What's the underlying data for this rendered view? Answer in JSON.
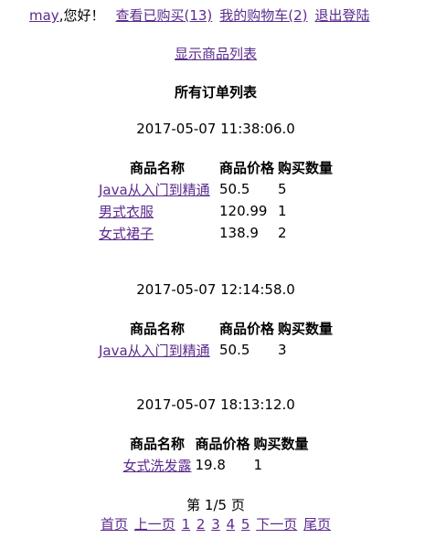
{
  "header": {
    "user_name": "may",
    "greeting": ",您好！",
    "purchased_link": "查看已购买(13)",
    "cart_link": "我的购物车(2)",
    "logout_link": "退出登陆"
  },
  "show_products_link": "显示商品列表",
  "page_title": "所有订单列表",
  "columns": {
    "name": "商品名称",
    "price": "商品价格",
    "qty": "购买数量"
  },
  "orders": [
    {
      "date": "2017-05-07 11:38:06.0",
      "items": [
        {
          "name": "Java从入门到精通",
          "price": "50.5",
          "qty": "5"
        },
        {
          "name": "男式衣服",
          "price": "120.99",
          "qty": "1"
        },
        {
          "name": "女式裙子",
          "price": "138.9",
          "qty": "2"
        }
      ]
    },
    {
      "date": "2017-05-07 12:14:58.0",
      "items": [
        {
          "name": "Java从入门到精通",
          "price": "50.5",
          "qty": "3"
        }
      ]
    },
    {
      "date": "2017-05-07 18:13:12.0",
      "items": [
        {
          "name": "女式洗发露",
          "price": "19.8",
          "qty": "1"
        }
      ]
    }
  ],
  "pager": {
    "info": "第 1/5 页",
    "first": "首页",
    "prev": "上一页",
    "pages": [
      "1",
      "2",
      "3",
      "4",
      "5"
    ],
    "next": "下一页",
    "last": "尾页"
  },
  "colors": {
    "link": "#5b2b8e",
    "text": "#000000",
    "background": "#ffffff"
  }
}
